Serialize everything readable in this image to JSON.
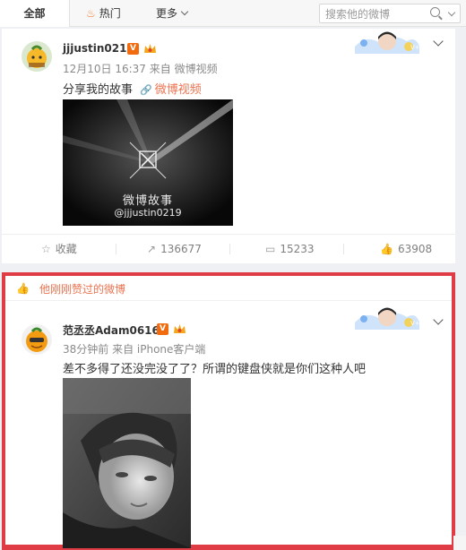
{
  "tabs": {
    "all": "全部",
    "hot": "热门",
    "more": "更多"
  },
  "search": {
    "placeholder": "搜索他的微博"
  },
  "post1": {
    "username": "jjjustin0219",
    "badge": "V",
    "time_source": "12月10日 16:37 来自 微博视频",
    "text": "分享我的故事",
    "video_link": "微博视频",
    "media_title": "微博故事",
    "media_handle": "@jjjustin0219",
    "actions": {
      "favorite": "收藏",
      "repost": "136677",
      "comment": "15233",
      "like": "63908"
    }
  },
  "post2": {
    "liked_notice": "他刚刚赞过的微博",
    "username": "范丞丞Adam0616",
    "badge": "V",
    "time_source": "38分钟前 来自 iPhone客户端",
    "text": "差不多得了还没完没了了？所谓的键盘侠就是你们这种人吧"
  },
  "colors": {
    "accent": "#eb7350",
    "highlight_border": "#e03c46",
    "vip_badge": "#f26c0f"
  },
  "icons": [
    "flame-icon",
    "chevron-down-icon",
    "search-icon",
    "star-icon",
    "repost-icon",
    "comment-icon",
    "like-icon",
    "link-icon"
  ]
}
